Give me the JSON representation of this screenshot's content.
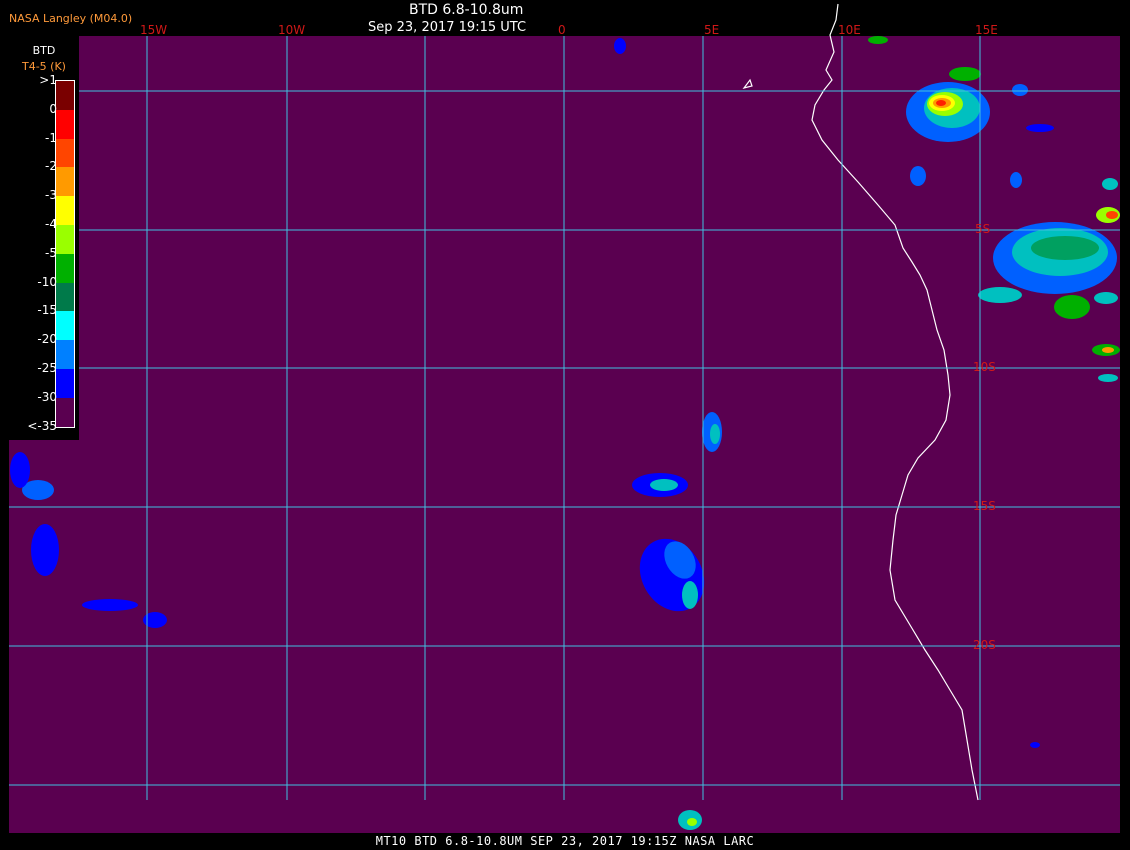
{
  "header": {
    "organization": "NASA Langley (M04.0)",
    "title": "BTD 6.8-10.8um",
    "timestamp": "Sep 23, 2017 19:15 UTC"
  },
  "footer": {
    "text": "MT10  BTD 6.8-10.8UM   SEP 23, 2017 19:15Z   NASA LARC"
  },
  "legend": {
    "title": "BTD",
    "units": "T4-5 (K)",
    "ticks": [
      ">1",
      "0",
      "-1",
      "-2",
      "-3",
      "-4",
      "-5",
      "-10",
      "-15",
      "-20",
      "-25",
      "-30",
      "<-35"
    ],
    "colors": [
      "#7a0000",
      "#ff0000",
      "#ff4500",
      "#ff9a00",
      "#ffff00",
      "#9aff00",
      "#00b000",
      "#007a4a",
      "#00ffff",
      "#0080ff",
      "#0000ff",
      "#5a0050"
    ]
  },
  "grid": {
    "longitude_labels": [
      "15W",
      "10W",
      "0",
      "5E",
      "10E",
      "15E"
    ],
    "latitude_labels": [
      "5S",
      "10S",
      "15S",
      "20S"
    ]
  },
  "colors": {
    "background": "#5a0050",
    "grid": "#40c0e0",
    "grid_label": "#d01818",
    "coast": "#ffffff"
  }
}
